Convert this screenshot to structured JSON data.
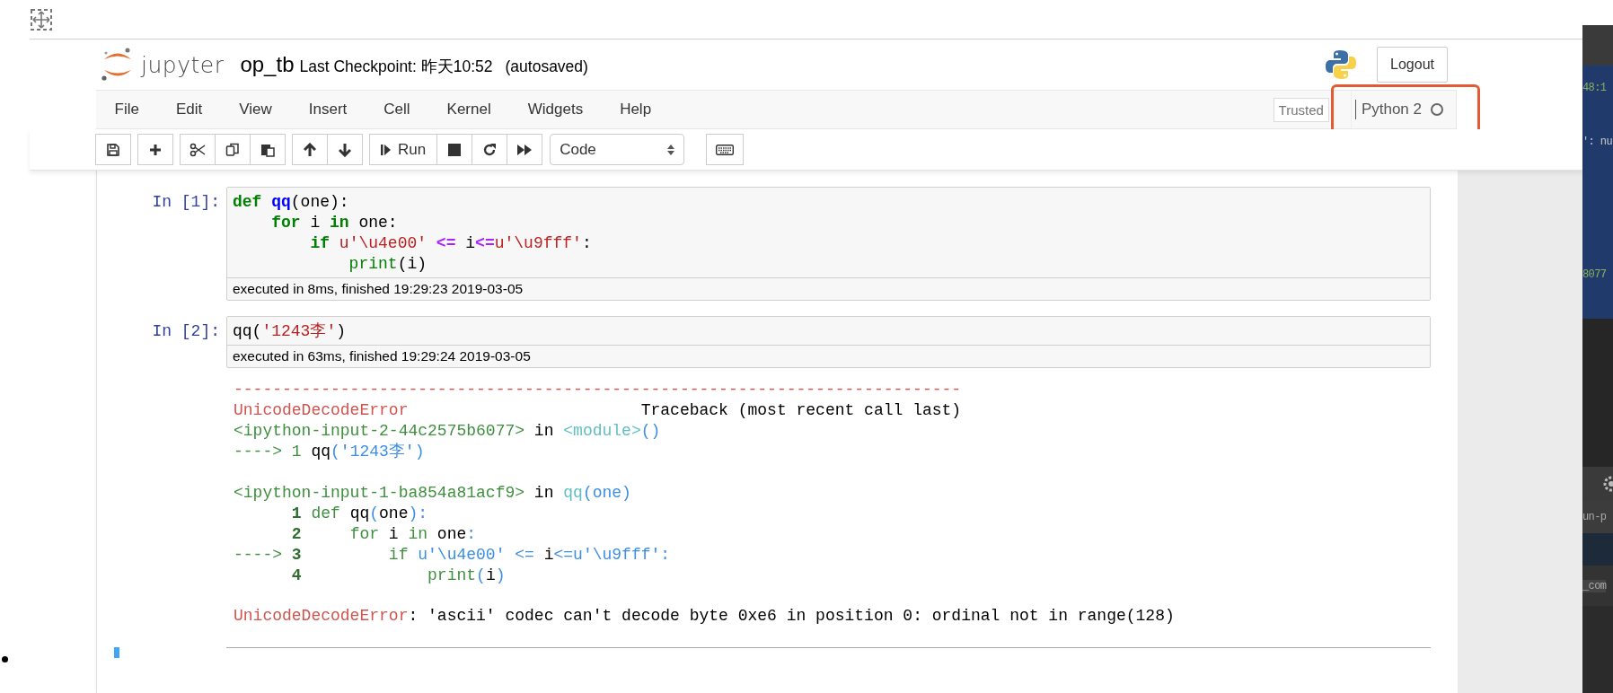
{
  "header": {
    "logo_text": "jupyter",
    "notebook_name": "op_tb",
    "checkpoint": "Last Checkpoint: 昨天10:52",
    "save_status": "(autosaved)",
    "logout": "Logout"
  },
  "menubar": {
    "items": [
      "File",
      "Edit",
      "View",
      "Insert",
      "Cell",
      "Kernel",
      "Widgets",
      "Help"
    ],
    "trusted": "Trusted",
    "kernel": {
      "name": "Python 2",
      "busy": false
    }
  },
  "toolbar": {
    "run_label": "Run",
    "cell_type": "Code"
  },
  "cells": [
    {
      "prompt": "In [1]:",
      "code": [
        [
          {
            "kind": "kw",
            "text": "def"
          },
          {
            "kind": "defname",
            "text": " qq"
          },
          {
            "kind": "plain",
            "text": "(one):"
          }
        ],
        [
          {
            "kind": "kw",
            "text": "    for"
          },
          {
            "kind": "plain",
            "text": " i "
          },
          {
            "kind": "kw",
            "text": "in"
          },
          {
            "kind": "plain",
            "text": " one:"
          }
        ],
        [
          {
            "kind": "kw",
            "text": "        if"
          },
          {
            "kind": "str",
            "text": " u'\\u4e00'"
          },
          {
            "kind": "op",
            "text": " <="
          },
          {
            "kind": "plain",
            "text": " i"
          },
          {
            "kind": "op",
            "text": "<="
          },
          {
            "kind": "str",
            "text": "u'\\u9fff'"
          },
          {
            "kind": "plain",
            "text": ":"
          }
        ],
        [
          {
            "kind": "builtin",
            "text": "            print"
          },
          {
            "kind": "plain",
            "text": "(i)"
          }
        ]
      ],
      "exec_info": "executed in 8ms, finished 19:29:23 2019-03-05"
    },
    {
      "prompt": "In [2]:",
      "code": [
        [
          {
            "kind": "plain",
            "text": "qq("
          },
          {
            "kind": "str",
            "text": "'1243李'"
          },
          {
            "kind": "plain",
            "text": ")"
          }
        ]
      ],
      "exec_info": "executed in 63ms, finished 19:29:24 2019-03-05",
      "output": [
        [
          [
            {
              "kind": "red",
              "text": "---------------------------------------------------------------------------"
            }
          ],
          [
            {
              "kind": "red",
              "text": "UnicodeDecodeError"
            },
            {
              "kind": "plain",
              "text": "                        Traceback (most recent call last)"
            }
          ],
          [
            {
              "kind": "green",
              "text": "<ipython-input-2-44c2575b6077>"
            },
            {
              "kind": "plain",
              "text": " in "
            },
            {
              "kind": "cyan",
              "text": "<module>"
            },
            {
              "kind": "blue",
              "text": "()"
            }
          ],
          [
            {
              "kind": "green",
              "text": "----> 1 "
            },
            {
              "kind": "plain",
              "text": "qq"
            },
            {
              "kind": "blue",
              "text": "('1243李')"
            }
          ]
        ],
        [
          [
            {
              "kind": "green",
              "text": "<ipython-input-1-ba854a81acf9>"
            },
            {
              "kind": "plain",
              "text": " in "
            },
            {
              "kind": "cyan",
              "text": "qq"
            },
            {
              "kind": "blue",
              "text": "(one)"
            }
          ],
          [
            {
              "kind": "greenbold",
              "text": "      1"
            },
            {
              "kind": "green",
              "text": " def"
            },
            {
              "kind": "plain",
              "text": " qq"
            },
            {
              "kind": "blue",
              "text": "("
            },
            {
              "kind": "plain",
              "text": "one"
            },
            {
              "kind": "blue",
              "text": "):"
            }
          ],
          [
            {
              "kind": "greenbold",
              "text": "      2"
            },
            {
              "kind": "green",
              "text": "     for"
            },
            {
              "kind": "plain",
              "text": " i "
            },
            {
              "kind": "green",
              "text": "in"
            },
            {
              "kind": "plain",
              "text": " one"
            },
            {
              "kind": "blue",
              "text": ":"
            }
          ],
          [
            {
              "kind": "green",
              "text": "----> "
            },
            {
              "kind": "greenbold",
              "text": "3"
            },
            {
              "kind": "green",
              "text": "         if"
            },
            {
              "kind": "blue",
              "text": " u'\\u4e00'"
            },
            {
              "kind": "blue",
              "text": " <="
            },
            {
              "kind": "plain",
              "text": " i"
            },
            {
              "kind": "blue",
              "text": "<="
            },
            {
              "kind": "blue",
              "text": "u'\\u9fff'"
            },
            {
              "kind": "blue",
              "text": ":"
            }
          ],
          [
            {
              "kind": "greenbold",
              "text": "      4"
            },
            {
              "kind": "green",
              "text": "             print"
            },
            {
              "kind": "blue",
              "text": "("
            },
            {
              "kind": "plain",
              "text": "i"
            },
            {
              "kind": "blue",
              "text": ")"
            }
          ]
        ],
        [
          [
            {
              "kind": "red",
              "text": "UnicodeDecodeError"
            },
            {
              "kind": "plain",
              "text": ": 'ascii' codec can't decode byte 0xe6 in position 0: ordinal not in range(128)"
            }
          ]
        ]
      ]
    }
  ],
  "background_editor": {
    "lines": [
      "48:1",
      "': nu",
      "8077",
      "un-p",
      "_com"
    ]
  }
}
